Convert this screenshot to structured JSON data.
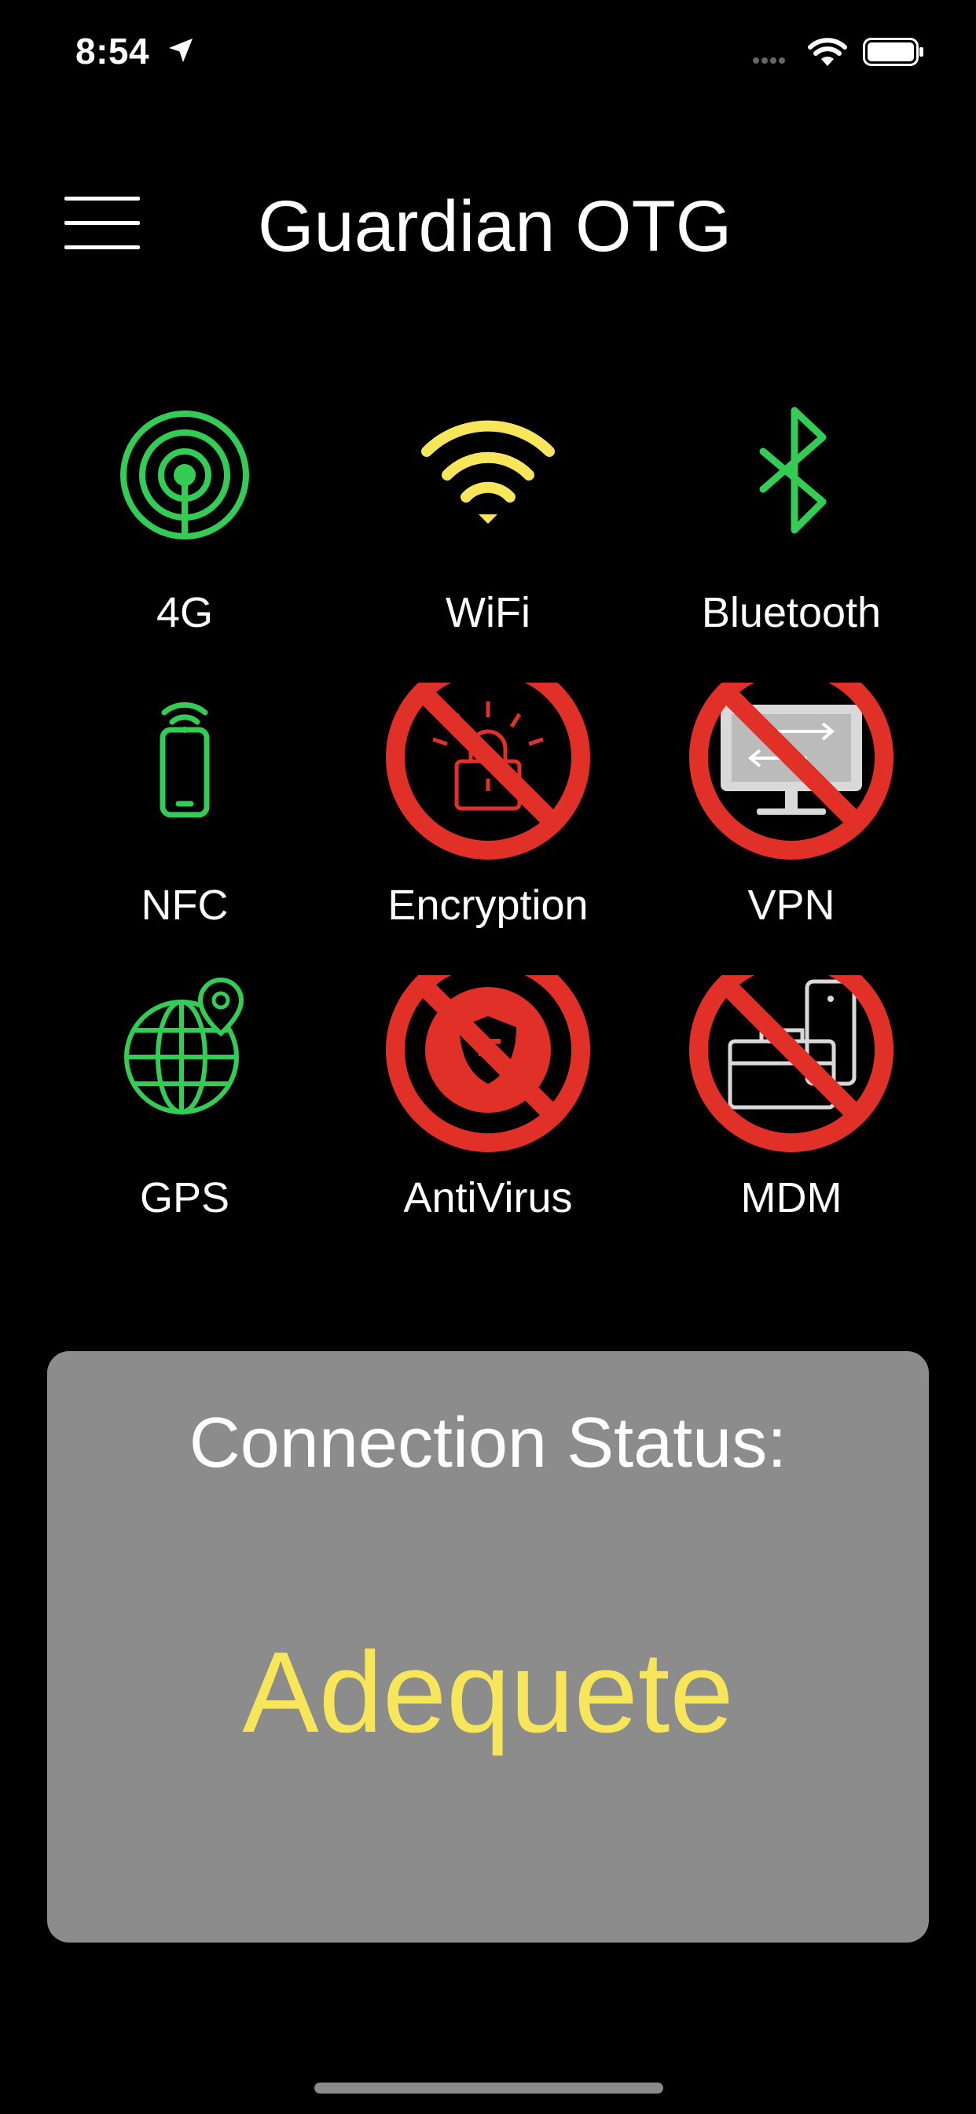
{
  "status_bar": {
    "time": "8:54"
  },
  "header": {
    "title": "Guardian OTG"
  },
  "features": [
    {
      "label": "4G",
      "icon": "cellular-tower-icon",
      "state": "ok",
      "color": "#33cc55"
    },
    {
      "label": "WiFi",
      "icon": "wifi-icon",
      "state": "warning",
      "color": "#f7e65a"
    },
    {
      "label": "Bluetooth",
      "icon": "bluetooth-icon",
      "state": "ok",
      "color": "#33cc55"
    },
    {
      "label": "NFC",
      "icon": "nfc-phone-icon",
      "state": "ok",
      "color": "#33cc55"
    },
    {
      "label": "Encryption",
      "icon": "encryption-lock-icon",
      "state": "blocked",
      "color": "#e03028"
    },
    {
      "label": "VPN",
      "icon": "vpn-monitor-icon",
      "state": "blocked",
      "color": "#e03028"
    },
    {
      "label": "GPS",
      "icon": "gps-globe-icon",
      "state": "ok",
      "color": "#33cc55"
    },
    {
      "label": "AntiVirus",
      "icon": "antivirus-shield-icon",
      "state": "blocked",
      "color": "#e03028"
    },
    {
      "label": "MDM",
      "icon": "mdm-briefcase-icon",
      "state": "blocked",
      "color": "#e03028"
    }
  ],
  "connection": {
    "heading": "Connection Status:",
    "value": "Adequete",
    "value_color": "#f7e65a"
  }
}
